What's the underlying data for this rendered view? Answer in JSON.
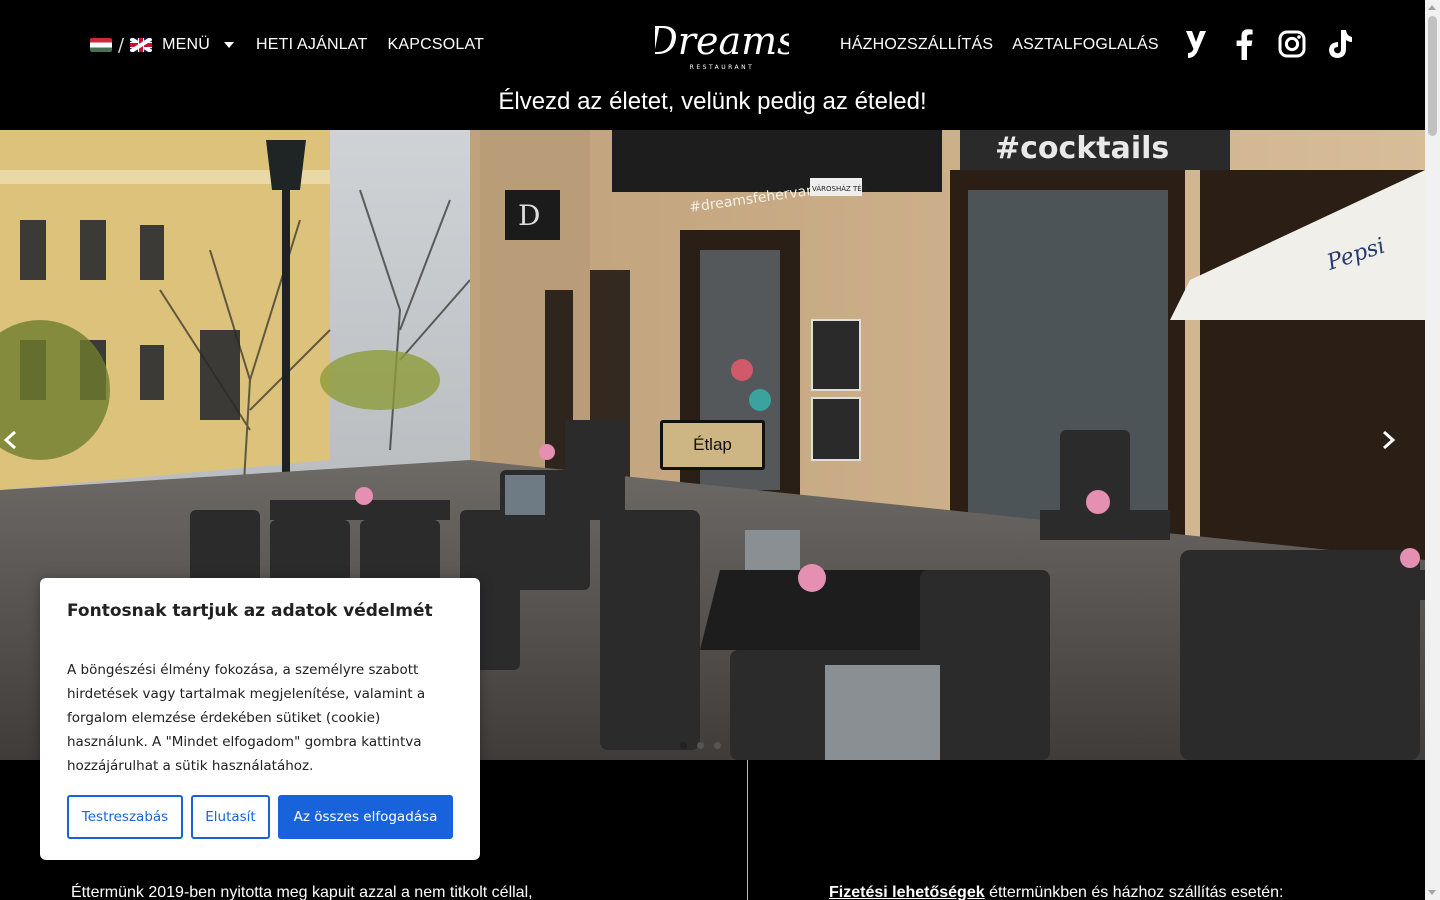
{
  "header": {
    "languages": [
      "hu",
      "en"
    ],
    "language_separator": "/",
    "menu_label": "MENÜ",
    "nav_left": [
      "HETI AJÁNLAT",
      "KAPCSOLAT"
    ],
    "nav_right": [
      "HÁZHOZSZÁLLÍTÁS",
      "ASZTALFOGLALÁS"
    ],
    "logo_text": "Dreams",
    "logo_subtext": "RESTAURANT",
    "social_icons": [
      "yelp-icon",
      "facebook-icon",
      "instagram-icon",
      "tiktok-icon"
    ],
    "tagline": "Élvezd az életet, velünk pedig az ételed!"
  },
  "hero": {
    "cta_label": "Étlap",
    "cta_color": "#cdb683",
    "sign_cocktails": "#cocktails",
    "sign_hashtag": "#dreamsfehervar",
    "sign_street": "VÁROSHÁZ TÉR",
    "slides": 3,
    "active_slide": 1
  },
  "content": {
    "about_text": "Éttermünk 2019-ben nyitotta meg kapuit azzal a nem titkolt céllal,",
    "payment_label": "Fizetési lehetőségek",
    "payment_text": " éttermünkben és házhoz szállítás esetén:"
  },
  "cookie_banner": {
    "title": "Fontosnak tartjuk az adatok védelmét",
    "body": "A böngészési élmény fokozása, a személyre szabott hirdetések vagy tartalmak megjelenítése, valamint a forgalom elemzése érdekében sütiket (cookie) használunk. A \"Mindet elfogadom\" gombra kattintva hozzájárulhat a sütik használatához.",
    "customize_label": "Testreszabás",
    "reject_label": "Elutasít",
    "accept_label": "Az összes elfogadása",
    "accent_color": "#1863dc"
  }
}
